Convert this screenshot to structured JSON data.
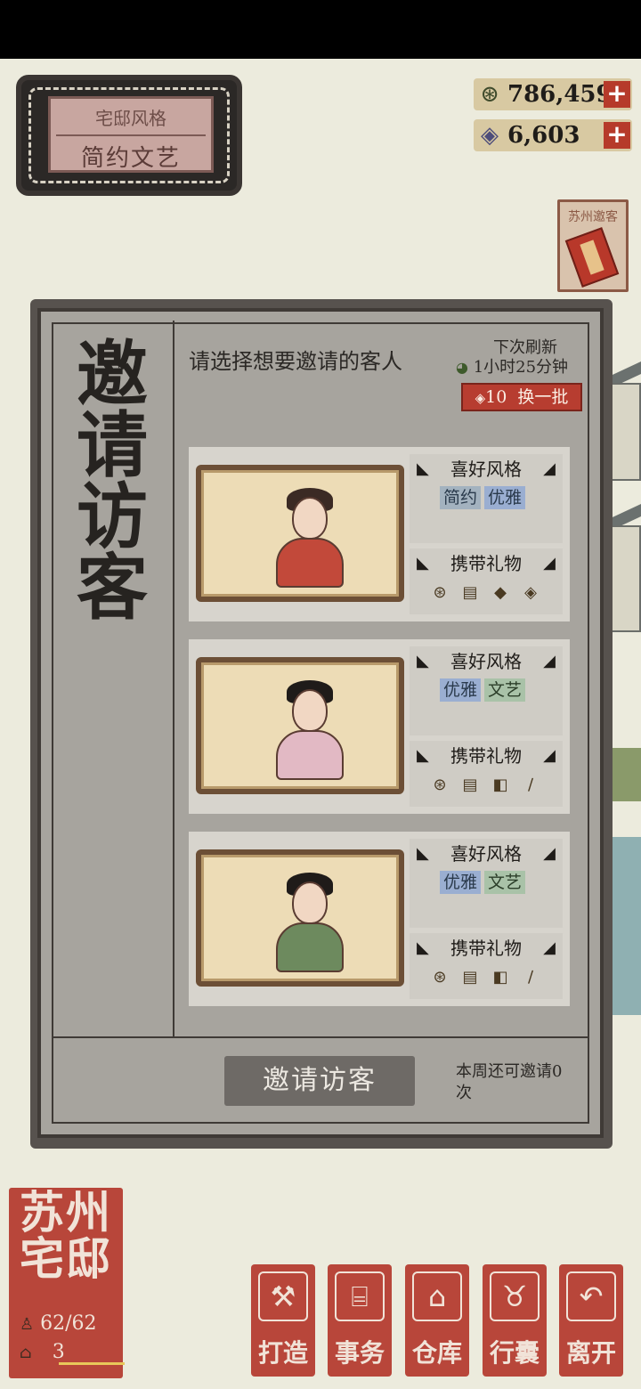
{
  "style_plaque": {
    "label": "宅邸风格",
    "value": "简约文艺"
  },
  "currencies": [
    {
      "icon": "coin-icon",
      "amount": "786,459",
      "plus": "+"
    },
    {
      "icon": "gem-icon",
      "amount": "6,603",
      "plus": "+"
    }
  ],
  "side_tab": {
    "label": "苏州邀客"
  },
  "panel": {
    "title": [
      "邀",
      "请",
      "访",
      "客"
    ],
    "prompt": "请选择想要邀请的客人",
    "refresh_label": "下次刷新",
    "refresh_time": "1小时25分钟",
    "swap": {
      "cost": "10",
      "label": "换一批"
    },
    "pref_title": "喜好风格",
    "gift_title": "携带礼物",
    "guests": [
      {
        "tags": [
          {
            "label": "简约",
            "kind": "simple"
          },
          {
            "label": "优雅",
            "kind": "elegant"
          }
        ],
        "gifts": [
          "coin-icon",
          "scroll-icon",
          "parcel-icon",
          "gem-icon"
        ],
        "palette": {
          "robe": "#c2493a",
          "hair": "#3b2a24"
        }
      },
      {
        "tags": [
          {
            "label": "优雅",
            "kind": "elegant"
          },
          {
            "label": "文艺",
            "kind": "art"
          }
        ],
        "gifts": [
          "coin-icon",
          "scroll-icon",
          "ink-stone-icon",
          "brush-icon"
        ],
        "palette": {
          "robe": "#e2b9c4",
          "hair": "#1f1b19"
        }
      },
      {
        "tags": [
          {
            "label": "优雅",
            "kind": "elegant"
          },
          {
            "label": "文艺",
            "kind": "art"
          }
        ],
        "gifts": [
          "coin-icon",
          "scroll-icon",
          "ink-stone-icon",
          "brush-icon"
        ],
        "palette": {
          "robe": "#6d8a5e",
          "hair": "#1f1b19"
        }
      }
    ],
    "invite_button": "邀请访客",
    "week_note": "本周还可邀请0次"
  },
  "mansion": {
    "name": "苏州宅邸",
    "population": "62/62",
    "level": "3"
  },
  "actions": [
    {
      "label": "打造",
      "icon": "hammer-icon"
    },
    {
      "label": "事务",
      "icon": "desk-icon"
    },
    {
      "label": "仓库",
      "icon": "warehouse-icon"
    },
    {
      "label": "行囊",
      "icon": "bag-icon"
    },
    {
      "label": "离开",
      "icon": "return-icon"
    }
  ]
}
